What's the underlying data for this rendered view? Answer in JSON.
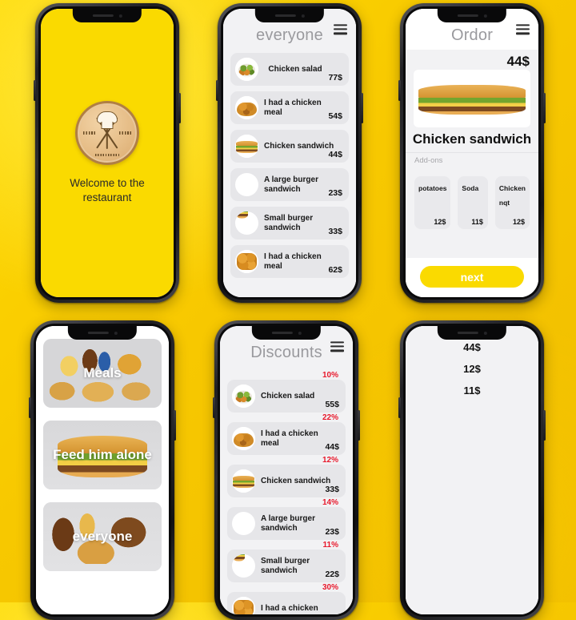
{
  "app": {
    "brand_yellow": "#fada00",
    "accent_red": "#e8192c",
    "card_gray": "#e6e6e9",
    "screen_gray": "#f2f2f4"
  },
  "splash": {
    "logo_name": "restaurant-logo",
    "welcome_text": "Welcome to the restaurant"
  },
  "menu_screen": {
    "title": "everyone",
    "menu_icon": "hamburger-menu-icon",
    "items": [
      {
        "name": "Chicken salad",
        "price": "77$",
        "art": "salad"
      },
      {
        "name": "I had a chicken meal",
        "price": "54$",
        "art": "bowl"
      },
      {
        "name": "Chicken sandwich",
        "price": "44$",
        "art": "sandwich"
      },
      {
        "name": "A large burger sandwich",
        "price": "23$",
        "art": "bigburger"
      },
      {
        "name": "Small burger sandwich",
        "price": "33$",
        "art": "burger"
      },
      {
        "name": "I had a chicken meal",
        "price": "62$",
        "art": "nugget"
      }
    ]
  },
  "order_screen": {
    "title": "Ordor",
    "menu_icon": "hamburger-menu-icon",
    "price": "44$",
    "product_name": "Chicken sandwich",
    "addons_label": "Add-ons",
    "addons": [
      {
        "name": "potatoes",
        "price": "12$",
        "art": "fries"
      },
      {
        "name": "Soda",
        "price": "11$",
        "art": "soda"
      },
      {
        "name": "Chicken nqt",
        "price": "12$",
        "art": "nugget"
      }
    ],
    "next_label": "next"
  },
  "categories_screen": {
    "items": [
      {
        "label": "Meals",
        "art": "meals"
      },
      {
        "label": "Feed him alone",
        "art": "feed"
      },
      {
        "label": "everyone",
        "art": "every"
      }
    ]
  },
  "discounts_screen": {
    "title": "Discounts",
    "menu_icon": "hamburger-menu-icon",
    "items": [
      {
        "name": "Chicken salad",
        "price": "55$",
        "discount": "10%",
        "art": "salad"
      },
      {
        "name": "I had a chicken meal",
        "price": "44$",
        "discount": "22%",
        "art": "bowl"
      },
      {
        "name": "Chicken sandwich",
        "price": "33$",
        "discount": "12%",
        "art": "sandwich"
      },
      {
        "name": "A large burger sandwich",
        "price": "23$",
        "discount": "14%",
        "art": "bigburger"
      },
      {
        "name": "Small burger sandwich",
        "price": "22$",
        "discount": "11%",
        "art": "burger"
      },
      {
        "name": "I had a chicken",
        "price": "",
        "discount": "30%",
        "art": "nugget"
      }
    ]
  },
  "cart_screen": {
    "items": [
      {
        "price": "44$",
        "art": "sandwich"
      },
      {
        "price": "12$",
        "art": "fries"
      },
      {
        "price": "11$",
        "art": "soda"
      }
    ]
  }
}
